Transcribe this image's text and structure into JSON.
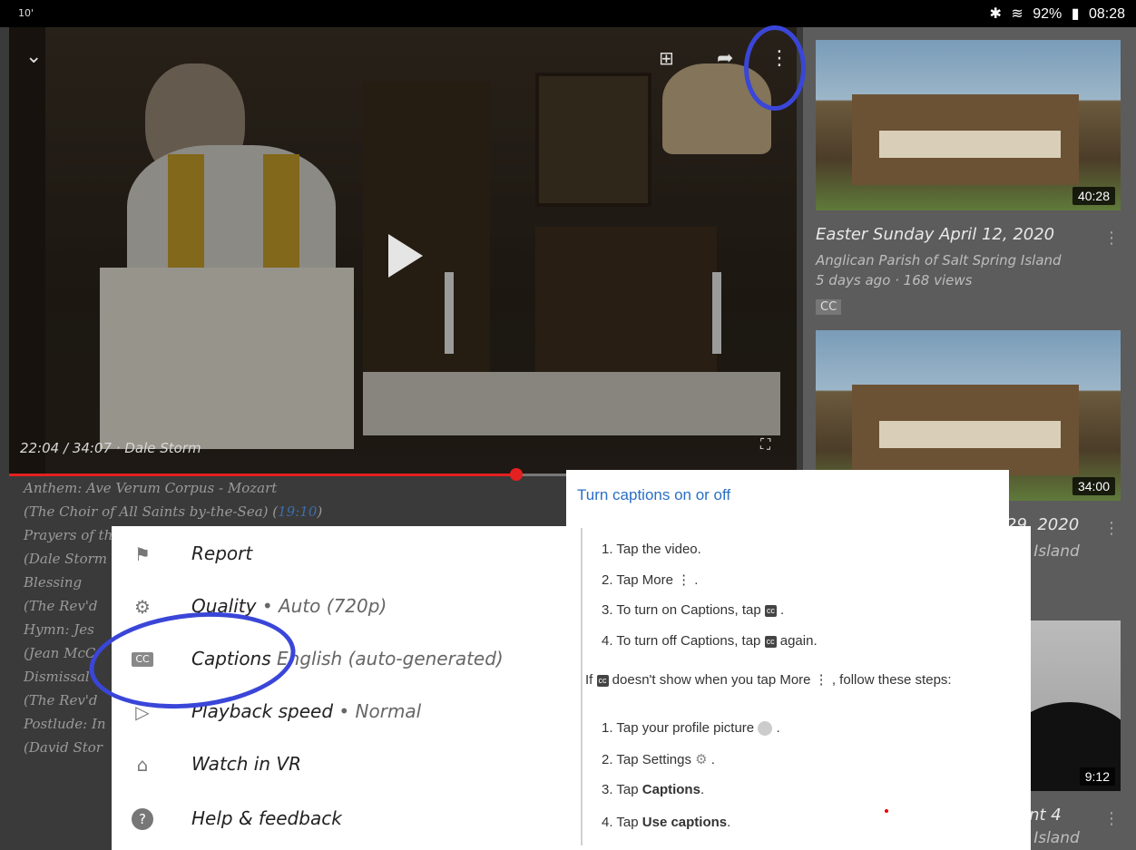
{
  "status": {
    "left": "10'",
    "battery": "92%",
    "time": "08:28"
  },
  "video": {
    "time_text": "22:04 / 34:07 · Dale Storm",
    "progress": 0.643
  },
  "related": [
    {
      "title": "Easter Sunday April 12, 2020",
      "channel": "Anglican Parish of Salt Spring Island",
      "meta": "5 days ago · 168 views",
      "badge": "CC",
      "duration": "40:28"
    },
    {
      "title": "",
      "channel": "",
      "meta": "",
      "duration": "34:00",
      "title_partial": "29, 2020",
      "channel_partial": "g Island"
    },
    {
      "duration": "9:12",
      "title_partial": "ent 4",
      "channel_partial": "g Island"
    }
  ],
  "description": [
    {
      "text": "Anthem: Ave Verum Corpus - Mozart"
    },
    {
      "text": " (The Choir of All Saints by-the-Sea) (",
      "ts": "19:10",
      "after": ")"
    },
    {
      "text": "Prayers of th"
    },
    {
      "text": " (Dale Storm"
    },
    {
      "text": "Blessing"
    },
    {
      "text": " (The Rev'd"
    },
    {
      "text": "Hymn: Jes"
    },
    {
      "text": " (Jean McC"
    },
    {
      "text": "Dismissal"
    },
    {
      "text": " (The Rev'd"
    },
    {
      "text": "Postlude: In"
    },
    {
      "text": " (David Stor"
    }
  ],
  "menu": [
    {
      "icon": "flag-icon",
      "glyph": "⚑",
      "label": "Report",
      "value": ""
    },
    {
      "icon": "gear-icon",
      "glyph": "⚙",
      "label": "Quality",
      "value": " •  Auto (720p)"
    },
    {
      "icon": "cc-icon",
      "glyph": "CC",
      "label": "Captions",
      "value": "    English (auto-generated)"
    },
    {
      "icon": "playback-speed-icon",
      "glyph": "▷",
      "label": "Playback speed",
      "value": " •  Normal"
    },
    {
      "icon": "vr-icon",
      "glyph": "⌂",
      "label": "Watch in VR",
      "value": ""
    },
    {
      "icon": "help-icon",
      "glyph": "?",
      "label": "Help & feedback",
      "value": ""
    }
  ],
  "help": {
    "title": "Turn captions on or off",
    "steps_a": [
      "1. Tap the video.",
      "2. Tap More",
      "3. To turn on Captions, tap",
      "4. To turn off Captions, tap"
    ],
    "steps_a_suffix": [
      "",
      " ⋮ .",
      " .",
      " again."
    ],
    "if_text": "If",
    "if_text2": " doesn't show when you tap More ⋮ , follow these steps:",
    "steps_b": [
      "1. Tap your profile picture",
      "2. Tap Settings",
      "3. Tap ",
      "4. Tap "
    ],
    "steps_b_bold": [
      "",
      "",
      "Captions",
      "Use captions"
    ],
    "steps_b_suffix": [
      " .",
      " .",
      ".",
      "."
    ]
  }
}
